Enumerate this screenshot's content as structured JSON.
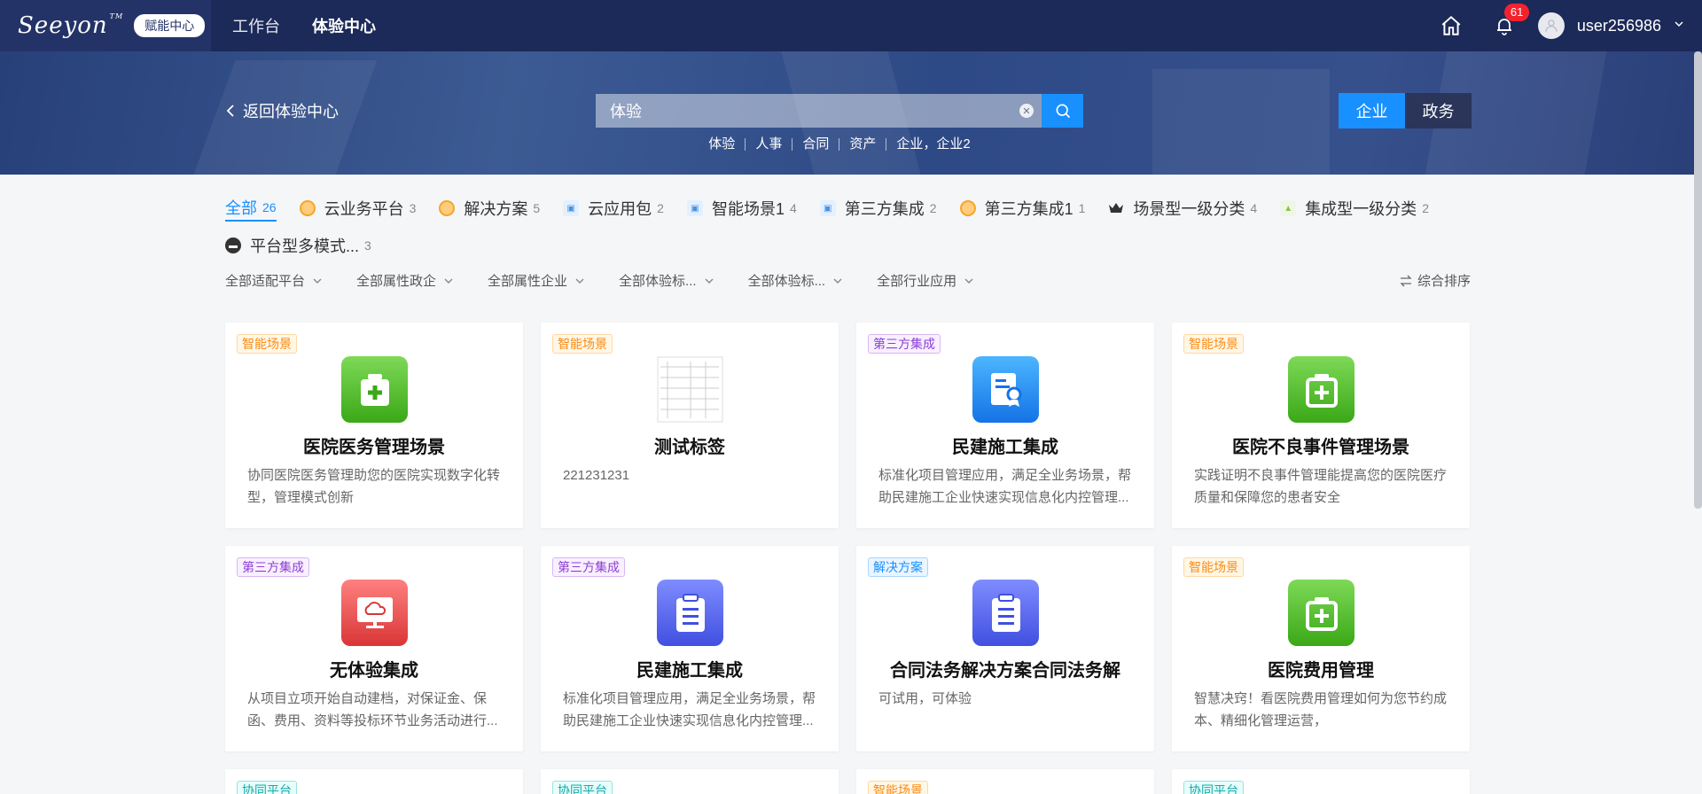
{
  "topbar": {
    "logo_text": "Seeyon",
    "logo_tm": "TM",
    "badge": "赋能中心",
    "nav": [
      {
        "label": "工作台",
        "active": false
      },
      {
        "label": "体验中心",
        "active": true
      }
    ],
    "notification_count": "61",
    "username": "user256986"
  },
  "banner": {
    "back_label": "返回体验中心",
    "search_value": "体验",
    "hot_tags": [
      "体验",
      "人事",
      "合同",
      "资产",
      "企业，企业2"
    ],
    "segment": [
      {
        "label": "企业",
        "active": true
      },
      {
        "label": "政务",
        "active": false
      }
    ]
  },
  "categories": [
    {
      "label": "全部",
      "count": "26",
      "icon": "none",
      "active": true
    },
    {
      "label": "云业务平台",
      "count": "3",
      "icon": "orange-circle-icon"
    },
    {
      "label": "解决方案",
      "count": "5",
      "icon": "orange-circle-icon"
    },
    {
      "label": "云应用包",
      "count": "2",
      "icon": "cloud-package-icon"
    },
    {
      "label": "智能场景1",
      "count": "4",
      "icon": "cloud-package-icon"
    },
    {
      "label": "第三方集成",
      "count": "2",
      "icon": "cloud-package-icon"
    },
    {
      "label": "第三方集成1",
      "count": "1",
      "icon": "orange-circle-icon"
    },
    {
      "label": "场景型一级分类",
      "count": "4",
      "icon": "crown-icon"
    },
    {
      "label": "集成型一级分类",
      "count": "2",
      "icon": "image-icon"
    },
    {
      "label": "平台型多模式...",
      "count": "3",
      "icon": "black-circle-icon"
    }
  ],
  "filters": [
    "全部适配平台",
    "全部属性政企",
    "全部属性企业",
    "全部体验标...",
    "全部体验标...",
    "全部行业应用"
  ],
  "sort_label": "综合排序",
  "cards": [
    {
      "tag": "智能场景",
      "tag_color": "orange",
      "title": "医院医务管理场景",
      "desc": "协同医院医务管理助您的医院实现数字化转型，管理模式创新",
      "icon": "medical-kit-icon",
      "icon_color": "#52c41a"
    },
    {
      "tag": "智能场景",
      "tag_color": "orange",
      "title": "测试标签",
      "desc": "221231231",
      "icon": "document-thumbnail-icon",
      "icon_color": "#ffffff"
    },
    {
      "tag": "第三方集成",
      "tag_color": "purple",
      "title": "民建施工集成",
      "desc": "标准化项目管理应用，满足全业务场景，帮助民建施工企业快速实现信息化内控管理...",
      "icon": "certificate-icon",
      "icon_color": "#1e9bff"
    },
    {
      "tag": "智能场景",
      "tag_color": "orange",
      "title": "医院不良事件管理场景",
      "desc": "实践证明不良事件管理能提高您的医院医疗质量和保障您的患者安全",
      "icon": "medical-kit-icon",
      "icon_color": "#52c41a"
    },
    {
      "tag": "第三方集成",
      "tag_color": "purple",
      "title": "无体验集成",
      "desc": "从项目立项开始自动建档，对保证金、保函、费用、资料等投标环节业务活动进行...",
      "icon": "cloud-monitor-icon",
      "icon_color": "#f05a5a"
    },
    {
      "tag": "第三方集成",
      "tag_color": "purple",
      "title": "民建施工集成",
      "desc": "标准化项目管理应用，满足全业务场景，帮助民建施工企业快速实现信息化内控管理...",
      "icon": "clipboard-icon",
      "icon_color": "#5b6cf0"
    },
    {
      "tag": "解决方案",
      "tag_color": "blue",
      "title": "合同法务解决方案合同法务解",
      "desc": "可试用，可体验",
      "icon": "clipboard-icon",
      "icon_color": "#5b6cf0"
    },
    {
      "tag": "智能场景",
      "tag_color": "orange",
      "title": "医院费用管理",
      "desc": "智慧决窍！看医院费用管理如何为您节约成本、精细化管理运营，",
      "icon": "medical-kit-icon",
      "icon_color": "#52c41a"
    },
    {
      "tag": "协同平台",
      "tag_color": "cyan",
      "title": "",
      "desc": "",
      "icon": "",
      "icon_color": ""
    },
    {
      "tag": "协同平台",
      "tag_color": "cyan",
      "title": "",
      "desc": "",
      "icon": "",
      "icon_color": ""
    },
    {
      "tag": "智能场景",
      "tag_color": "orange",
      "title": "",
      "desc": "",
      "icon": "",
      "icon_color": ""
    },
    {
      "tag": "协同平台",
      "tag_color": "cyan",
      "title": "",
      "desc": "",
      "icon": "",
      "icon_color": ""
    }
  ]
}
